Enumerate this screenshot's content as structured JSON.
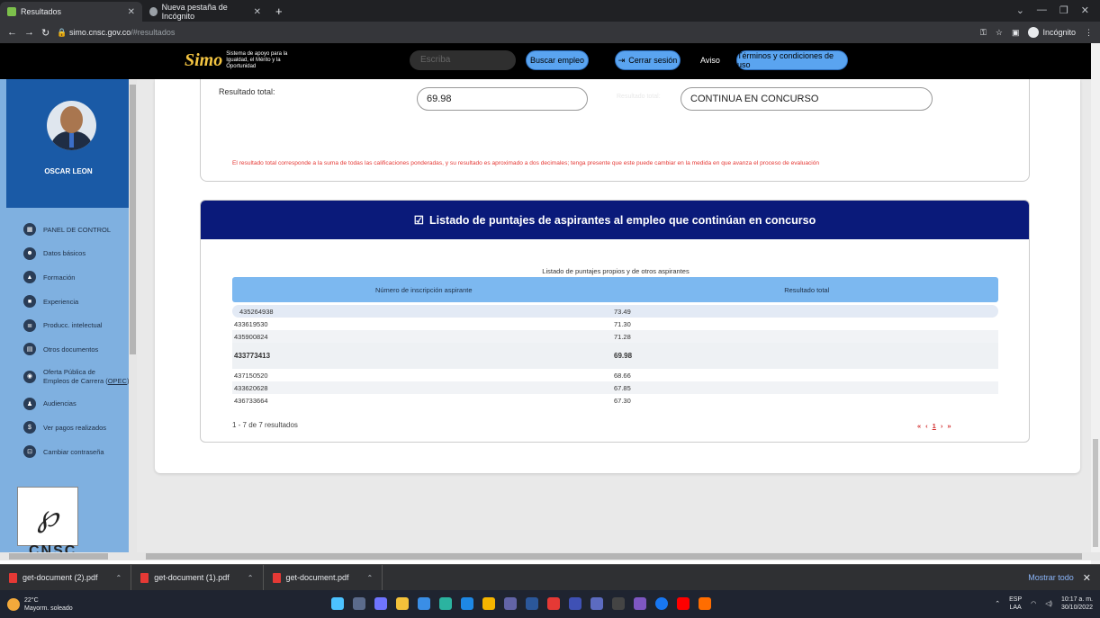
{
  "browser": {
    "tabs": [
      {
        "title": "Resultados",
        "active": true
      },
      {
        "title": "Nueva pestaña de Incógnito",
        "active": false
      }
    ],
    "url_host": "simo.cnsc.gov.co",
    "url_rest": "/#resultados",
    "incognito_label": "Incógnito"
  },
  "header": {
    "logo_mark": "Simo",
    "logo_tagline": "Sistema de apoyo para la Igualdad, el Mérito y la Oportunidad",
    "search_placeholder": "Escriba",
    "search_button": "Buscar empleo",
    "logout_button": "Cerrar sesión",
    "notice_link": "Aviso",
    "terms_button": "Términos y condiciones de uso"
  },
  "sidebar": {
    "user_name": "OSCAR LEON",
    "items": [
      {
        "label": "PANEL DE CONTROL",
        "icon": "dashboard-icon"
      },
      {
        "label": "Datos básicos",
        "icon": "people-icon"
      },
      {
        "label": "Formación",
        "icon": "graduation-icon"
      },
      {
        "label": "Experiencia",
        "icon": "briefcase-icon"
      },
      {
        "label": "Producc. intelectual",
        "icon": "book-icon"
      },
      {
        "label": "Otros documentos",
        "icon": "document-icon"
      },
      {
        "label": "Oferta Pública de",
        "label2": "Empleos de Carrera (",
        "label3": "OPEC",
        "label4": ")",
        "icon": "globe-icon"
      },
      {
        "label": "Audiencias",
        "icon": "audience-icon"
      },
      {
        "label": "Ver pagos realizados",
        "icon": "dollar-icon"
      },
      {
        "label": "Cambiar contraseña",
        "icon": "lock-icon"
      }
    ],
    "footer_logo_text": "CNSC"
  },
  "result": {
    "total_label": "Resultado total:",
    "total_value": "69.98",
    "status_label": "Resultado total:",
    "status_value": "CONTINUA EN CONCURSO",
    "note": "El resultado total corresponde a la suma de todas las calificaciones ponderadas, y su resultado es aproximado a dos decimales; tenga presente que este puede cambiar en la medida en que avanza el proceso de evaluación"
  },
  "ranking": {
    "title": "Listado de puntajes de aspirantes al empleo que continúan en concurso",
    "caption": "Listado de puntajes propios y de otros aspirantes",
    "col_id": "Número de inscripción aspirante",
    "col_score": "Resultado total",
    "rows": [
      {
        "id": "435264938",
        "score": "73.49"
      },
      {
        "id": "433619530",
        "score": "71.30"
      },
      {
        "id": "435900824",
        "score": "71.28"
      },
      {
        "id": "433773413",
        "score": "69.98"
      },
      {
        "id": "437150520",
        "score": "68.66"
      },
      {
        "id": "433620628",
        "score": "67.85"
      },
      {
        "id": "436733664",
        "score": "67.30"
      }
    ],
    "count_text": "1 - 7 de 7 resultados",
    "pager": {
      "first": "«",
      "prev": "‹",
      "page": "1",
      "next": "›",
      "last": "»"
    }
  },
  "downloads": {
    "files": [
      "get-document (2).pdf",
      "get-document (1).pdf",
      "get-document.pdf"
    ],
    "show_all": "Mostrar todo"
  },
  "taskbar": {
    "temp": "22°C",
    "weather": "Mayorm. soleado",
    "lang1": "ESP",
    "lang2": "LAA",
    "time": "10:17 a. m.",
    "date": "30/10/2022"
  }
}
